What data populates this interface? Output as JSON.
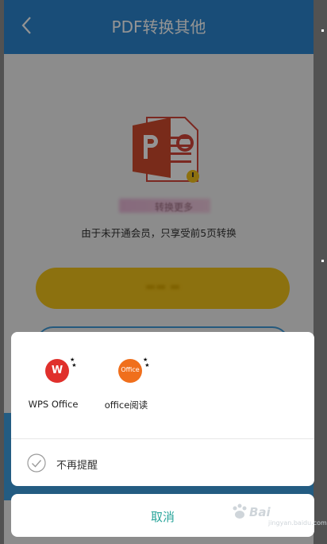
{
  "header": {
    "title": "PDF转换其他"
  },
  "notice": "由于未开通会员，只享受前5页转换",
  "blurred_caption": "转换更多",
  "share_sheet": {
    "apps": [
      {
        "label": "WPS Office",
        "icon": "wps-office-icon",
        "glyph": "W",
        "color": "#e0302c"
      },
      {
        "label": "office阅读",
        "icon": "office-reader-icon",
        "glyph": "Office",
        "color": "#f06f1c"
      }
    ],
    "dont_remind_label": "不再提醒"
  },
  "cancel_label": "取消",
  "colors": {
    "header": "#2b86cf",
    "primary_button": "#f2c31a",
    "accent": "#2aa59b"
  },
  "watermark": {
    "text": "Bai",
    "sub": "jingyan.baidu.com"
  }
}
